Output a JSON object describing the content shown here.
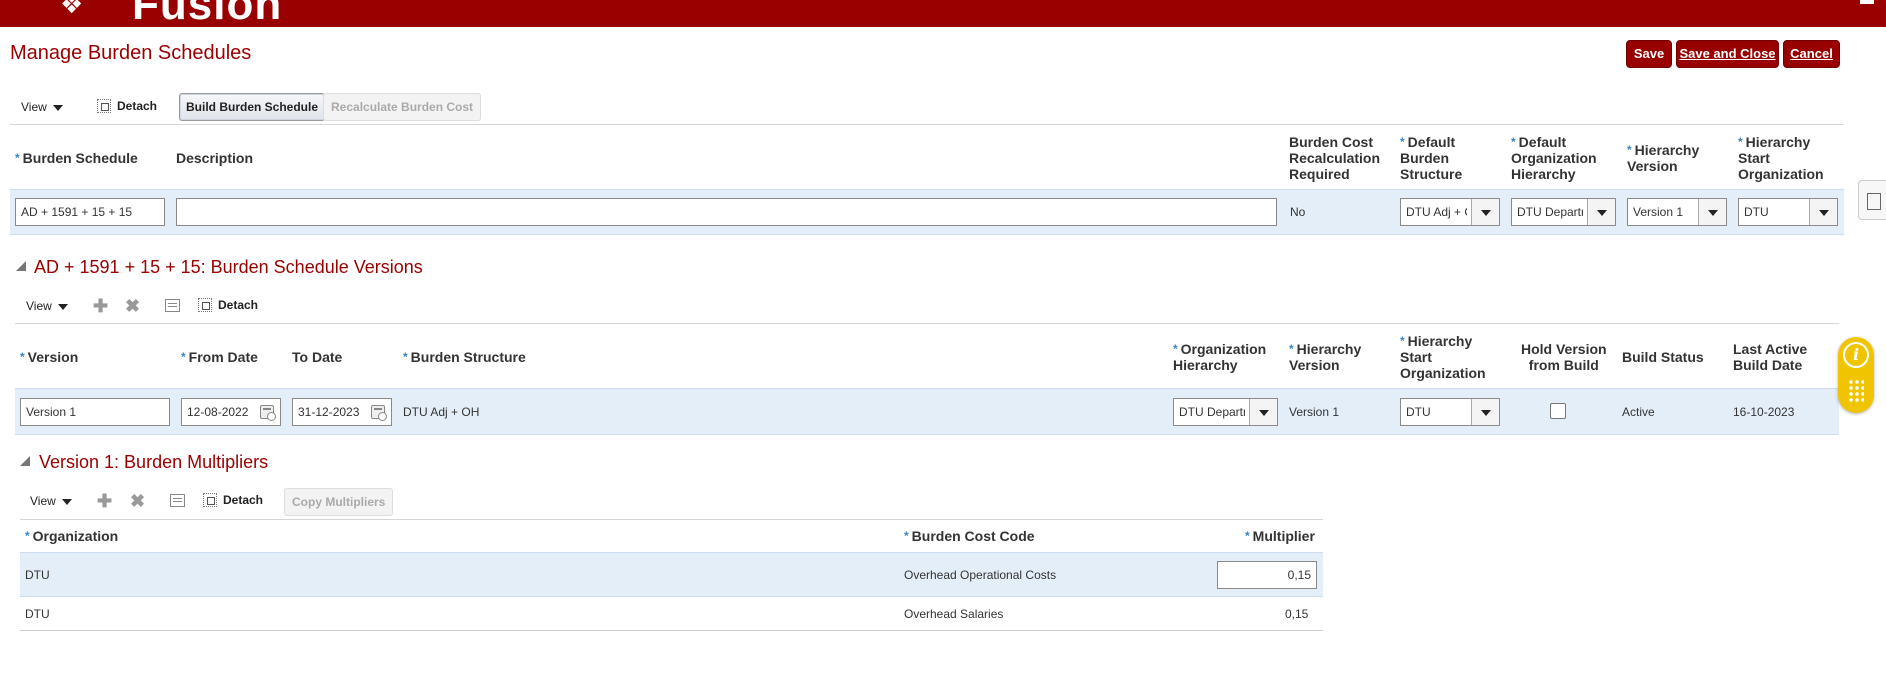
{
  "app": {
    "brand": "Fusion"
  },
  "page": {
    "title": "Manage Burden Schedules"
  },
  "header_buttons": {
    "save": "Save",
    "save_close": "Save and Close",
    "cancel": "Cancel"
  },
  "toolbar1": {
    "view": "View",
    "detach": "Detach",
    "build": "Build Burden Schedule",
    "recalc": "Recalculate Burden Cost"
  },
  "schedule_table": {
    "headers": {
      "burden_schedule": "Burden Schedule",
      "description": "Description",
      "recalc_required": [
        "Burden Cost",
        "Recalculation",
        "Required"
      ],
      "default_structure": [
        "Default",
        "Burden",
        "Structure"
      ],
      "default_org_hierarchy": [
        "Default",
        "Organization",
        "Hierarchy"
      ],
      "hierarchy_version": [
        "Hierarchy",
        "Version"
      ],
      "hierarchy_start_org": [
        "Hierarchy",
        "Start",
        "Organization"
      ]
    },
    "row": {
      "burden_schedule": "AD + 1591 + 15 + 15",
      "description": "",
      "recalc_required": "No",
      "default_structure": "DTU Adj + OH",
      "default_org_hierarchy": "DTU Department",
      "hierarchy_version": "Version 1",
      "hierarchy_start_org": "DTU"
    }
  },
  "versions_section": {
    "title": "AD + 1591 + 15 + 15: Burden Schedule Versions",
    "toolbar": {
      "view": "View",
      "detach": "Detach"
    },
    "headers": {
      "version": "Version",
      "from_date": "From Date",
      "to_date": "To Date",
      "burden_structure": "Burden Structure",
      "org_hierarchy": [
        "Organization",
        "Hierarchy"
      ],
      "hierarchy_version": [
        "Hierarchy",
        "Version"
      ],
      "hierarchy_start_org": [
        "Hierarchy",
        "Start",
        "Organization"
      ],
      "hold_version": [
        "Hold Version",
        "from Build"
      ],
      "build_status": "Build Status",
      "last_active": [
        "Last Active",
        "Build Date"
      ]
    },
    "row": {
      "version": "Version 1",
      "from_date": "12-08-2022",
      "to_date": "31-12-2023",
      "burden_structure": "DTU Adj + OH",
      "org_hierarchy": "DTU Department",
      "hierarchy_version": "Version 1",
      "hierarchy_start_org": "DTU",
      "hold_version": false,
      "build_status": "Active",
      "last_active": "16-10-2023"
    }
  },
  "multipliers_section": {
    "title": "Version 1: Burden Multipliers",
    "toolbar": {
      "view": "View",
      "detach": "Detach",
      "copy": "Copy Multipliers"
    },
    "headers": {
      "organization": "Organization",
      "burden_cost_code": "Burden Cost Code",
      "multiplier": "Multiplier"
    },
    "rows": [
      {
        "organization": "DTU",
        "burden_cost_code": "Overhead Operational Costs",
        "multiplier": "0,15"
      },
      {
        "organization": "DTU",
        "burden_cost_code": "Overhead Salaries",
        "multiplier": "0,15"
      }
    ]
  },
  "colors": {
    "brand": "#990000",
    "selected_row": "#e4eef9",
    "required": "#3a82c4",
    "help": "#f0c400"
  },
  "icons": [
    "detach-icon",
    "add-icon",
    "delete-icon",
    "freeze-icon",
    "calendar-icon",
    "help-icon",
    "panel-icon"
  ]
}
